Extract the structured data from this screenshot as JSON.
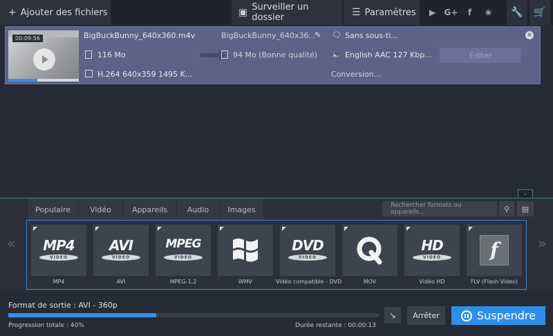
{
  "topbar": {
    "add_label": "Ajouter des fichiers",
    "watch_label": "Surveiller un dossier",
    "settings_label": "Paramètres",
    "social": [
      "youtube-icon",
      "google-plus-icon",
      "facebook-icon",
      "vk-icon"
    ]
  },
  "file": {
    "duration": "00:09:56",
    "source_name": "BigBuckBunny_640x360.m4v",
    "source_size": "116 Mo",
    "source_codec": "H.264 640x359 1495 K...",
    "output_name": "BigBuckBunny_640x36...",
    "output_size": "94 Mo (Bonne qualité)",
    "subtitles": "Sans sous-ti...",
    "audio": "English AAC 127 Kbp...",
    "status": "Conversion...",
    "edit_label": "Éditer",
    "thumbnail_progress": 0.41
  },
  "tabs": [
    {
      "label": "Populaire"
    },
    {
      "label": "Vidéo"
    },
    {
      "label": "Appareils"
    },
    {
      "label": "Audio"
    },
    {
      "label": "Images"
    }
  ],
  "search": {
    "placeholder": "Rechercher formats ou appareils..."
  },
  "formats": [
    {
      "logo": "MP4",
      "sub": "VIDEO",
      "label": "MP4"
    },
    {
      "logo": "AVI",
      "sub": "VIDEO",
      "label": "AVI"
    },
    {
      "logo": "MPEG",
      "sub": "VIDEO",
      "label": "MPEG-1,2"
    },
    {
      "logo": "",
      "sub": "",
      "label": "WMV"
    },
    {
      "logo": "DVD",
      "sub": "VIDEO",
      "label": "Vidéo compatible - DVD"
    },
    {
      "logo": "",
      "sub": "",
      "label": "MOV"
    },
    {
      "logo": "HD",
      "sub": "VIDEO",
      "label": "Vidéo HD"
    },
    {
      "logo": "",
      "sub": "",
      "label": "FLV (Flash Video)"
    }
  ],
  "bottom": {
    "output_label": "Format de sortie :  AVI - 360p",
    "progress_label": "Progression totale :  40%",
    "progress_value": 0.4,
    "remaining_label": "Durée restante :  00:00:13",
    "stop_label": "Arrêter",
    "suspend_label": "Suspendre"
  }
}
